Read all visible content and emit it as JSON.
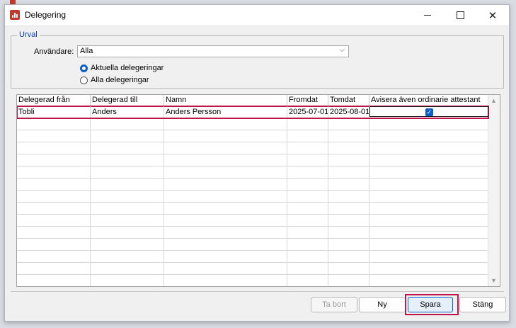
{
  "window": {
    "title": "Delegering",
    "minimize_icon": "minimize-icon",
    "maximize_icon": "maximize-icon",
    "close_icon": "close-icon",
    "close_glyph": "✕"
  },
  "urval": {
    "legend": "Urval",
    "user_label": "Användare:",
    "user_value": "Alla",
    "user_options_glyph": "⌵",
    "radio_current": {
      "label": "Aktuella delegeringar",
      "selected": true
    },
    "radio_all": {
      "label": "Alla delegeringar",
      "selected": false
    }
  },
  "grid": {
    "columns": [
      "Delegerad från",
      "Delegerad till",
      "Namn",
      "Fromdat",
      "Tomdat",
      "Avisera även ordinarie attestant"
    ],
    "rows": [
      {
        "from": "Tobli",
        "to": "Anders",
        "name": "Anders Persson",
        "fromdat": "2025-07-01",
        "tomdat": "2025-08-01",
        "avisera": true,
        "selected": true
      }
    ],
    "empty_rows": 14,
    "scroll_up_glyph": "▲",
    "scroll_down_glyph": "▼"
  },
  "buttons": {
    "tabort": {
      "label": "Ta bort",
      "enabled": false
    },
    "ny": {
      "label": "Ny",
      "enabled": true
    },
    "spara": {
      "label": "Spara",
      "enabled": true,
      "focused": true
    },
    "stang": {
      "label": "Stäng",
      "enabled": true
    }
  },
  "colors": {
    "accent": "#0a5fc9",
    "highlight": "#c0144b",
    "legend": "#0a3ca6"
  }
}
